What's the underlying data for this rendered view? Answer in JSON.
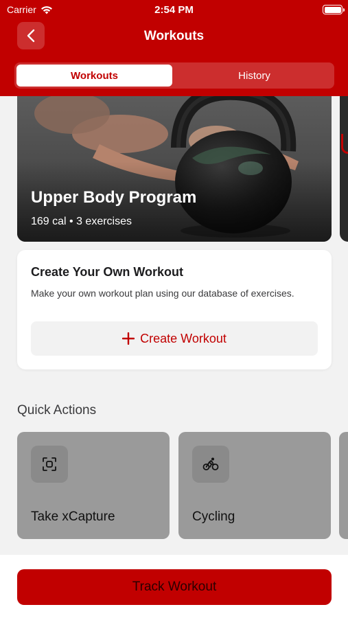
{
  "status_bar": {
    "carrier": "Carrier",
    "time": "2:54 PM"
  },
  "nav": {
    "title": "Workouts",
    "back_icon": "chevron-left-icon"
  },
  "tabs": [
    {
      "label": "Workouts",
      "selected": true
    },
    {
      "label": "History",
      "selected": false
    }
  ],
  "program": {
    "title": "Upper Body Program",
    "meta": "169 cal • 3 exercises"
  },
  "create": {
    "title": "Create Your Own Workout",
    "description": "Make your own workout plan using our database of exercises.",
    "button_label": "Create Workout",
    "button_icon": "plus-icon"
  },
  "quick_actions": {
    "title": "Quick Actions",
    "items": [
      {
        "label": "Take xCapture",
        "icon": "scan-icon"
      },
      {
        "label": "Cycling",
        "icon": "cycling-icon"
      }
    ]
  },
  "footer": {
    "track_label": "Track Workout"
  },
  "colors": {
    "accent": "#c10000",
    "background": "#f2f2f2"
  }
}
